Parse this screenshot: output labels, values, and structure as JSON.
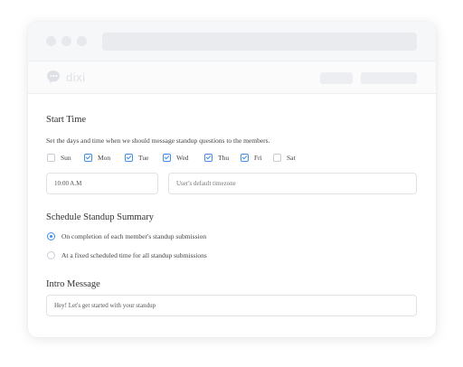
{
  "browser": {
    "address_placeholder": ""
  },
  "app": {
    "logo_text": "dixi"
  },
  "start_time": {
    "title": "Start Time",
    "description": "Set the days and time when we should message standup questions to the members.",
    "days": [
      {
        "label": "Sun",
        "checked": false
      },
      {
        "label": "Mon",
        "checked": true
      },
      {
        "label": "Tue",
        "checked": true
      },
      {
        "label": "Wed",
        "checked": true
      },
      {
        "label": "Thu",
        "checked": true
      },
      {
        "label": "Fri",
        "checked": true
      },
      {
        "label": "Sat",
        "checked": false
      }
    ],
    "time_value": "10:00 A.M",
    "timezone_placeholder": "User's default timezone"
  },
  "summary": {
    "title": "Schedule Standup Summary",
    "options": [
      {
        "label": "On completion of each member's standup submission",
        "selected": true
      },
      {
        "label": "At a fixed scheduled time for all standup submissions",
        "selected": false
      }
    ]
  },
  "intro": {
    "title": "Intro Message",
    "value": "Hey! Let's get started with your standup"
  },
  "colors": {
    "accent": "#3f8ee8",
    "border": "#dfe2e7",
    "placeholder_gray": "#e9ebef"
  }
}
